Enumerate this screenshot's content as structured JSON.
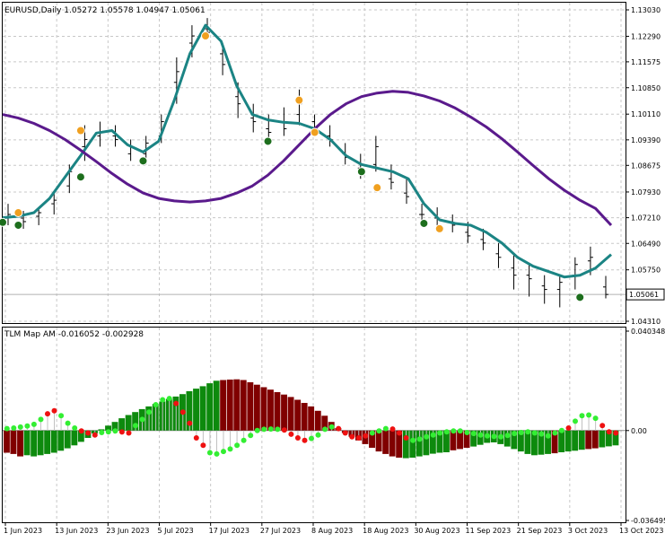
{
  "main": {
    "header": "EURUSD,Daily  1.05272 1.05578 1.04947 1.05061",
    "y_ticks": [
      "1.13030",
      "1.12290",
      "1.11575",
      "1.10850",
      "1.10110",
      "1.09390",
      "1.08675",
      "1.07930",
      "1.07210",
      "1.06490",
      "1.05750",
      "1.05061",
      "1.04310"
    ],
    "last_price": "1.05061"
  },
  "sub": {
    "header": "TLM Map AM -0.016052 -0.002928",
    "y_ticks": [
      "0.040348",
      "0.00",
      "-0.036495"
    ]
  },
  "x_ticks": [
    "1 Jun 2023",
    "13 Jun 2023",
    "23 Jun 2023",
    "5 Jul 2023",
    "17 Jul 2023",
    "27 Jul 2023",
    "8 Aug 2023",
    "18 Aug 2023",
    "30 Aug 2023",
    "11 Sep 2023",
    "21 Sep 2023",
    "3 Oct 2023",
    "13 Oct 2023"
  ],
  "colors": {
    "fast_ma": "#1b8484",
    "slow_ma": "#5a1a8c",
    "hist_up": "#0d8a0d",
    "hist_down": "#800000",
    "dot_up": "#33ee33",
    "dot_down": "#ee1111",
    "signal_up": "#1d6e1d",
    "signal_down": "#f0a020"
  },
  "chart_data": [
    {
      "type": "line",
      "title": "EURUSD,Daily",
      "subtitle": "1.05272 1.05578 1.04947 1.05061",
      "ylim": [
        1.0431,
        1.1303
      ],
      "x": [
        "1 Jun 2023",
        "13 Jun 2023",
        "23 Jun 2023",
        "5 Jul 2023",
        "17 Jul 2023",
        "27 Jul 2023",
        "8 Aug 2023",
        "18 Aug 2023",
        "30 Aug 2023",
        "11 Sep 2023",
        "21 Sep 2023",
        "3 Oct 2023",
        "13 Oct 2023"
      ],
      "series": [
        {
          "values": [
            1.0721,
            1.0725,
            1.0735,
            1.0775,
            1.0835,
            1.0895,
            1.0958,
            1.0965,
            1.0925,
            1.0905,
            1.0935,
            1.105,
            1.118,
            1.126,
            1.1215,
            1.109,
            1.101,
            1.0995,
            1.0988,
            1.0985,
            1.097,
            1.094,
            1.0895,
            1.087,
            1.086,
            1.085,
            1.083,
            1.076,
            1.0715,
            1.0705,
            1.07,
            1.068,
            1.065,
            1.061,
            1.0585,
            1.057,
            1.0555,
            1.056,
            1.058,
            1.0618
          ]
        },
        {
          "values": [
            1.101,
            1.1,
            1.0985,
            1.0965,
            1.094,
            1.091,
            1.0878,
            1.0845,
            1.0815,
            1.079,
            1.0775,
            1.0768,
            1.0765,
            1.0768,
            1.0775,
            1.079,
            1.081,
            1.084,
            1.088,
            1.0925,
            1.097,
            1.101,
            1.104,
            1.106,
            1.107,
            1.1075,
            1.1072,
            1.1062,
            1.1048,
            1.1028,
            1.1003,
            1.0975,
            1.0942,
            1.0905,
            1.0867,
            1.083,
            1.0798,
            1.077,
            1.0747,
            1.07
          ]
        }
      ],
      "candles": [
        [
          1.072,
          1.076,
          1.07,
          1.073
        ],
        [
          1.072,
          1.074,
          1.069,
          1.071
        ],
        [
          1.0725,
          1.0745,
          1.07,
          1.0735
        ],
        [
          1.076,
          1.079,
          1.073,
          1.077
        ],
        [
          1.081,
          1.087,
          1.079,
          1.085
        ],
        [
          1.092,
          1.098,
          1.088,
          1.094
        ],
        [
          1.095,
          1.099,
          1.092,
          1.096
        ],
        [
          1.095,
          1.098,
          1.092,
          1.094
        ],
        [
          1.09,
          1.094,
          1.088,
          1.092
        ],
        [
          1.09,
          1.095,
          1.087,
          1.093
        ],
        [
          1.095,
          1.101,
          1.093,
          1.099
        ],
        [
          1.11,
          1.117,
          1.104,
          1.113
        ],
        [
          1.121,
          1.126,
          1.117,
          1.123
        ],
        [
          1.125,
          1.128,
          1.122,
          1.124
        ],
        [
          1.118,
          1.121,
          1.112,
          1.115
        ],
        [
          1.106,
          1.11,
          1.1,
          1.104
        ],
        [
          1.1,
          1.104,
          1.096,
          1.099
        ],
        [
          1.097,
          1.101,
          1.094,
          1.096
        ],
        [
          1.099,
          1.103,
          1.095,
          1.097
        ],
        [
          1.101,
          1.108,
          1.098,
          1.104
        ],
        [
          1.099,
          1.101,
          1.095,
          1.097
        ],
        [
          1.095,
          1.098,
          1.092,
          1.094
        ],
        [
          1.09,
          1.093,
          1.087,
          1.089
        ],
        [
          1.086,
          1.09,
          1.083,
          1.087
        ],
        [
          1.087,
          1.095,
          1.085,
          1.092
        ],
        [
          1.083,
          1.087,
          1.08,
          1.082
        ],
        [
          1.079,
          1.083,
          1.076,
          1.078
        ],
        [
          1.073,
          1.076,
          1.071,
          1.073
        ],
        [
          1.072,
          1.075,
          1.069,
          1.07
        ],
        [
          1.071,
          1.073,
          1.068,
          1.07
        ],
        [
          1.068,
          1.071,
          1.065,
          1.067
        ],
        [
          1.066,
          1.069,
          1.063,
          1.065
        ],
        [
          1.062,
          1.065,
          1.058,
          1.061
        ],
        [
          1.058,
          1.062,
          1.052,
          1.056
        ],
        [
          1.056,
          1.059,
          1.05,
          1.055
        ],
        [
          1.053,
          1.056,
          1.048,
          1.052
        ],
        [
          1.052,
          1.056,
          1.047,
          1.054
        ],
        [
          1.056,
          1.061,
          1.052,
          1.059
        ],
        [
          1.06,
          1.064,
          1.056,
          1.061
        ],
        [
          1.0527,
          1.0558,
          1.0495,
          1.0506
        ]
      ],
      "signals_up": [
        [
          0,
          1.0708
        ],
        [
          1,
          1.07
        ],
        [
          5,
          1.0835
        ],
        [
          9,
          1.088
        ],
        [
          17,
          1.0935
        ],
        [
          23,
          1.085
        ],
        [
          27,
          1.0705
        ],
        [
          37,
          1.0498
        ]
      ],
      "signals_down": [
        [
          1,
          1.0735
        ],
        [
          5,
          1.0965
        ],
        [
          13,
          1.123
        ],
        [
          19,
          1.105
        ],
        [
          20,
          1.096
        ],
        [
          24,
          1.0805
        ],
        [
          28,
          1.069
        ]
      ]
    },
    {
      "type": "bar",
      "title": "TLM Map AM",
      "subtitle": "-0.016052 -0.002928",
      "ylim": [
        -0.036495,
        0.040348
      ],
      "values": [
        -0.009,
        -0.0095,
        -0.0105,
        -0.01,
        -0.0105,
        -0.01,
        -0.0095,
        -0.009,
        -0.0082,
        -0.0072,
        -0.006,
        -0.0046,
        -0.003,
        -0.0012,
        0.0005,
        0.002,
        0.0035,
        0.005,
        0.0063,
        0.0075,
        0.0087,
        0.0098,
        0.0108,
        0.0118,
        0.0128,
        0.0138,
        0.0148,
        0.016,
        0.017,
        0.018,
        0.0192,
        0.0202,
        0.0205,
        0.0207,
        0.0208,
        0.0205,
        0.0196,
        0.0186,
        0.0176,
        0.0166,
        0.0156,
        0.0146,
        0.0136,
        0.0125,
        0.0112,
        0.0098,
        0.008,
        0.006,
        0.0035,
        0.001,
        -0.001,
        -0.0025,
        -0.004,
        -0.0055,
        -0.007,
        -0.0085,
        -0.0095,
        -0.0105,
        -0.011,
        -0.0112,
        -0.011,
        -0.0105,
        -0.01,
        -0.0094,
        -0.009,
        -0.0088,
        -0.008,
        -0.0075,
        -0.007,
        -0.0065,
        -0.0058,
        -0.005,
        -0.0048,
        -0.0055,
        -0.0065,
        -0.0075,
        -0.0085,
        -0.0095,
        -0.01,
        -0.0098,
        -0.0095,
        -0.0092,
        -0.0088,
        -0.0085,
        -0.0082,
        -0.0078,
        -0.0075,
        -0.0072,
        -0.0068,
        -0.0064,
        -0.006
      ],
      "colors": [
        "d",
        "d",
        "d",
        "u",
        "u",
        "u",
        "u",
        "u",
        "u",
        "u",
        "u",
        "u",
        "u",
        "u",
        "u",
        "u",
        "u",
        "u",
        "u",
        "u",
        "u",
        "u",
        "u",
        "u",
        "u",
        "u",
        "u",
        "u",
        "u",
        "u",
        "u",
        "u",
        "d",
        "d",
        "d",
        "d",
        "d",
        "d",
        "d",
        "d",
        "d",
        "d",
        "d",
        "d",
        "d",
        "d",
        "d",
        "d",
        "d",
        "d",
        "d",
        "d",
        "d",
        "d",
        "d",
        "d",
        "d",
        "d",
        "d",
        "u",
        "u",
        "u",
        "u",
        "u",
        "u",
        "u",
        "d",
        "d",
        "d",
        "u",
        "u",
        "u",
        "u",
        "u",
        "u",
        "u",
        "u",
        "u",
        "u",
        "u",
        "u",
        "d",
        "u",
        "u",
        "u",
        "u",
        "d",
        "d",
        "u",
        "u",
        "u"
      ],
      "signal": [
        0.0008,
        0.001,
        0.0014,
        0.0018,
        0.0025,
        0.0045,
        0.0068,
        0.008,
        0.006,
        0.003,
        0.001,
        -0.0002,
        -0.001,
        -0.0018,
        -0.0008,
        -0.0005,
        -0.0002,
        -0.0006,
        -0.001,
        0.002,
        0.0045,
        0.0075,
        0.0105,
        0.0125,
        0.013,
        0.011,
        0.0075,
        0.003,
        -0.003,
        -0.006,
        -0.009,
        -0.0095,
        -0.0085,
        -0.0075,
        -0.006,
        -0.004,
        -0.002,
        0.0,
        0.0005,
        0.0006,
        0.0005,
        0.0002,
        -0.0015,
        -0.003,
        -0.004,
        -0.0032,
        -0.0018,
        0.0005,
        0.0015,
        0.0008,
        -0.001,
        -0.0025,
        -0.003,
        -0.0022,
        -0.001,
        -0.0002,
        0.0008,
        0.0006,
        -0.001,
        -0.003,
        -0.004,
        -0.0035,
        -0.0025,
        -0.0018,
        -0.001,
        -0.0005,
        -0.0002,
        -0.0002,
        -0.0008,
        -0.0012,
        -0.0018,
        -0.0022,
        -0.0024,
        -0.0025,
        -0.002,
        -0.0012,
        -0.0008,
        -0.0005,
        -0.001,
        -0.0014,
        -0.0022,
        -0.001,
        0.0,
        0.001,
        0.0038,
        0.006,
        0.0063,
        0.005,
        0.002,
        -0.0005,
        -0.001
      ],
      "signal_colors": [
        "u",
        "u",
        "u",
        "u",
        "u",
        "u",
        "d",
        "d",
        "u",
        "u",
        "u",
        "d",
        "d",
        "d",
        "u",
        "u",
        "u",
        "d",
        "d",
        "u",
        "u",
        "u",
        "u",
        "u",
        "u",
        "d",
        "d",
        "d",
        "d",
        "d",
        "u",
        "u",
        "u",
        "u",
        "u",
        "u",
        "u",
        "u",
        "u",
        "u",
        "u",
        "d",
        "d",
        "d",
        "d",
        "u",
        "u",
        "u",
        "u",
        "d",
        "d",
        "d",
        "d",
        "d",
        "u",
        "u",
        "u",
        "d",
        "d",
        "d",
        "u",
        "u",
        "u",
        "u",
        "u",
        "u",
        "u",
        "u",
        "u",
        "u",
        "u",
        "u",
        "u",
        "u",
        "u",
        "u",
        "u",
        "u",
        "u",
        "u",
        "u",
        "u",
        "u",
        "d",
        "u",
        "u",
        "u",
        "u",
        "d",
        "d",
        "d"
      ]
    }
  ]
}
